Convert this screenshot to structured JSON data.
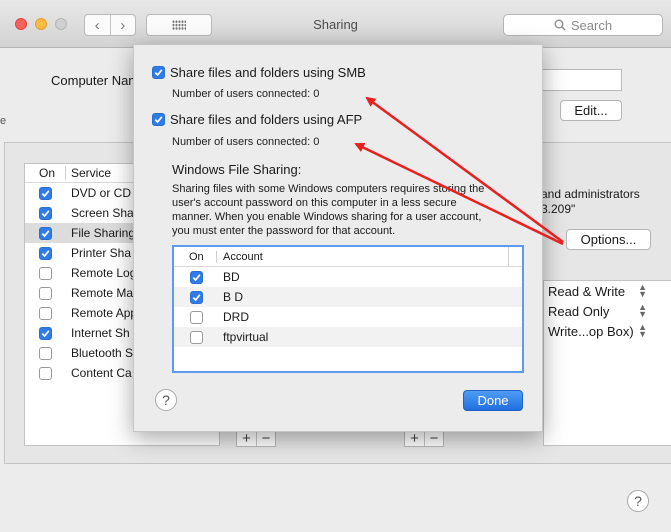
{
  "window": {
    "title": "Sharing"
  },
  "toolbar": {
    "back_glyph": "‹",
    "forward_glyph": "›",
    "search_placeholder": "Search"
  },
  "background": {
    "computer_name_label": "Computer Nam",
    "edit_label": "Edit...",
    "edge_mark": "e",
    "service_header_on": "On",
    "service_header_service": "Service",
    "services": [
      {
        "label": "DVD or CD",
        "checked": true,
        "selected": false
      },
      {
        "label": "Screen Sha",
        "checked": true,
        "selected": false
      },
      {
        "label": "File Sharing",
        "checked": true,
        "selected": true
      },
      {
        "label": "Printer Sha",
        "checked": true,
        "selected": false
      },
      {
        "label": "Remote Log",
        "checked": false,
        "selected": false
      },
      {
        "label": "Remote Ma",
        "checked": false,
        "selected": false
      },
      {
        "label": "Remote App",
        "checked": false,
        "selected": false
      },
      {
        "label": "Internet Sh",
        "checked": true,
        "selected": false
      },
      {
        "label": "Bluetooth S",
        "checked": false,
        "selected": false
      },
      {
        "label": "Content Ca",
        "checked": false,
        "selected": false
      }
    ],
    "right_text_1": "and administrators",
    "right_text_2": "3.209\"",
    "options_label": "Options...",
    "permissions": [
      "Read & Write",
      "Read Only",
      "Write...op Box)"
    ],
    "plus": "+",
    "minus": "−",
    "help": "?"
  },
  "sheet": {
    "smb_label": "Share files and folders using SMB",
    "smb_checked": true,
    "smb_users": "Number of users connected: 0",
    "afp_label": "Share files and folders using AFP",
    "afp_checked": true,
    "afp_users": "Number of users connected: 0",
    "wfs_title": "Windows File Sharing:",
    "wfs_desc": "Sharing files with some Windows computers requires storing the user's account password on this computer in a less secure manner.  When you enable Windows sharing for a user account, you must enter the password for that account.",
    "accounts_header_on": "On",
    "accounts_header_account": "Account",
    "accounts": [
      {
        "name": "BD",
        "checked": true
      },
      {
        "name": "B D",
        "checked": true
      },
      {
        "name": "DRD",
        "checked": false
      },
      {
        "name": "ftpvirtual",
        "checked": false
      }
    ],
    "help": "?",
    "done_label": "Done"
  },
  "colors": {
    "accent": "#2f7ce8",
    "arrow": "#e8201e"
  }
}
